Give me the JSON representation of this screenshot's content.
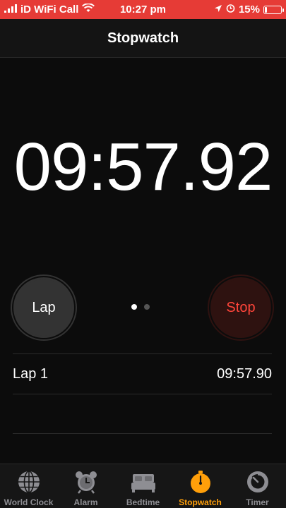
{
  "status_bar": {
    "carrier": "iD WiFi Call",
    "time": "10:27 pm",
    "battery_percent": "15%",
    "battery_level": 0.15,
    "background_color": "#e63b36"
  },
  "nav": {
    "title": "Stopwatch"
  },
  "stopwatch": {
    "time": "09:57.92"
  },
  "buttons": {
    "lap_label": "Lap",
    "stop_label": "Stop",
    "stop_color": "#ff453a"
  },
  "page_indicator": {
    "count": 2,
    "active_index": 0
  },
  "laps": [
    {
      "label": "Lap 1",
      "time": "09:57.90"
    }
  ],
  "tabs": [
    {
      "label": "World Clock",
      "icon": "globe-icon",
      "active": false
    },
    {
      "label": "Alarm",
      "icon": "alarm-clock-icon",
      "active": false
    },
    {
      "label": "Bedtime",
      "icon": "bed-icon",
      "active": false
    },
    {
      "label": "Stopwatch",
      "icon": "stopwatch-icon",
      "active": true
    },
    {
      "label": "Timer",
      "icon": "timer-icon",
      "active": false
    }
  ],
  "colors": {
    "accent": "#ff9f0a",
    "inactive": "#8e8e93"
  }
}
